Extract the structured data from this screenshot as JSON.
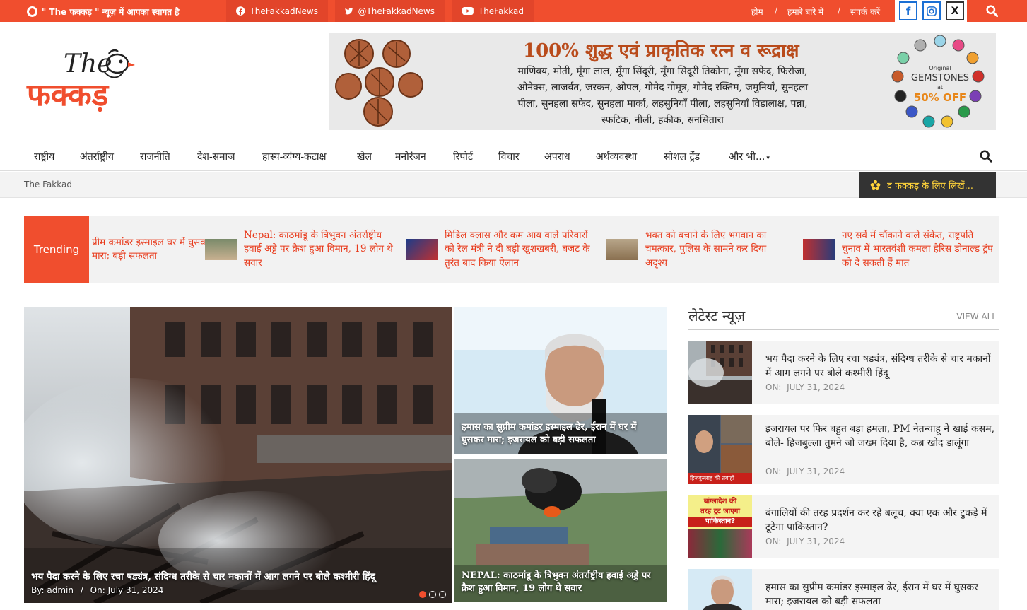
{
  "topbar": {
    "welcome": "\" The फक्कड़ \" न्यूज़ में आपका स्वागत है",
    "social": [
      {
        "icon": "facebook-icon",
        "label": "TheFakkadNews"
      },
      {
        "icon": "twitter-icon",
        "label": "@TheFakkadNews"
      },
      {
        "icon": "youtube-icon",
        "label": "TheFakkad"
      }
    ],
    "links": [
      "होम",
      "हमारे बारे में",
      "संपर्क करें"
    ],
    "separator": "/",
    "social_boxes": [
      "f",
      "ig",
      "X"
    ],
    "colors": {
      "primary": "#f04e2e",
      "dark": "#333333",
      "accent": "#ffd33a"
    }
  },
  "logo": {
    "text_top": "The",
    "text_main": "फक्कड़"
  },
  "banner": {
    "title": "100% शुद्ध एवं प्राकृतिक रत्न व रूद्राक्ष",
    "lines": [
      "माणिक्य, मोती, मूँगा लाल, मूँगा सिंदूरी, मूँगा सिंदूरी तिकोना, मूँगा सफेद, फिरोजा,",
      "ओनेक्स, लाजर्वत, जरकन, ओपल, गोमेद गोमूत्र, गोमेद रक्तिम, जमुनियाँ, सुनहला",
      "पीला, सुनहला सफेद, सुनहला मार्का, लहसुनियाँ पीला, लहसुनियाँ विडालाक्ष, पन्ना,",
      "स्फटिक, नीली, हकीक, सनसितारा"
    ],
    "badge_small": "Original",
    "badge_mid": "GEMSTONES",
    "badge_at": "at",
    "badge_off": "50% OFF"
  },
  "nav": {
    "items": [
      "राष्ट्रीय",
      "अंतर्राष्ट्रीय",
      "राजनीति",
      "देश-समाज",
      "हास्य-व्यंग्य-कटाक्ष",
      "खेल",
      "मनोरंजन",
      "रिपोर्ट",
      "विचार",
      "अपराध",
      "अर्थव्यवस्था",
      "सोशल ट्रेंड",
      "और भी..."
    ]
  },
  "breadcrumb": {
    "text": "The Fakkad",
    "write_button": "द फक्कड़ के लिए लिखें..."
  },
  "trending": {
    "label": "Trending",
    "items": [
      "प्रीम कमांडर इस्माइल घर में घुसकर मारा; बड़ी सफलता",
      "Nepal: काठमांडू के त्रिभुवन अंतर्राष्ट्रीय हवाई अड्डे पर क्रैश हुआ विमान, 19 लोग थे सवार",
      "मिडिल क्लास और कम आय वाले परिवारों को रेल मंत्री ने दी बड़ी खुशखबरी, बजट के तुरंत बाद किया ऐलान",
      "भक्त को बचाने के लिए भगवान का चमत्कार, पुलिस के सामने कर दिया अदृश्य",
      "नए सर्वे में चौंकाने वाले संकेत, राष्ट्रपति चुनाव में भारतवंशी कमला हैरिस डोनाल्ड ट्रंप को दे सकती हैं मात"
    ]
  },
  "featured": {
    "main_title": "भय पैदा करने के लिए रचा षड्यंत्र, संदिग्ध तरीके से चार मकानों में आग लगने पर बोले कश्मीरी हिंदू",
    "by_label": "By:",
    "author": "admin",
    "meta_sep": "/",
    "on_label": "On:",
    "date": "July 31, 2024",
    "side1_title": "हमास का सुप्रीम कमांडर इस्माइल ढेर, ईरान में घर में घुसकर मारा; इजरायल को बड़ी सफलता",
    "side2_title": "NEPAL: काठमांडू के त्रिभुवन अंतर्राष्ट्रीय हवाई अड्डे पर क्रैश हुआ विमान, 19 लोग थे सवार"
  },
  "latest": {
    "heading": "लेटेस्ट न्यूज़",
    "view_all": "VIEW ALL",
    "on_label": "ON:",
    "items": [
      {
        "title": "भय पैदा करने के लिए रचा षड्यंत्र, संदिग्ध तरीके से चार मकानों में आग लगने पर बोले कश्मीरी हिंदू",
        "date": "JULY 31, 2024"
      },
      {
        "title": "इजरायल पर फिर बहुत बड़ा हमला, PM नेतन्याहू ने खाई कसम, बोले- हिजबुल्ला तुमने जो जख्म दिया है, कब्र खोद डालूंगा",
        "date": "JULY 31, 2024",
        "thumb_caption": "हिजबुल्लाह की तबाही"
      },
      {
        "title": "बंगालियों की तरह प्रदर्शन कर रहे बलूच, क्या एक और टुकड़े में टूटेगा पाकिस्तान?",
        "date": "JULY 31, 2024",
        "thumb_lines": [
          "बांग्लादेश की",
          "तरह टूट जाएगा",
          "पाकिस्तान?"
        ]
      },
      {
        "title": "हमास का सुप्रीम कमांडर इस्माइल ढेर, ईरान में घर में घुसकर मारा; इजरायल को बड़ी सफलता"
      }
    ]
  }
}
